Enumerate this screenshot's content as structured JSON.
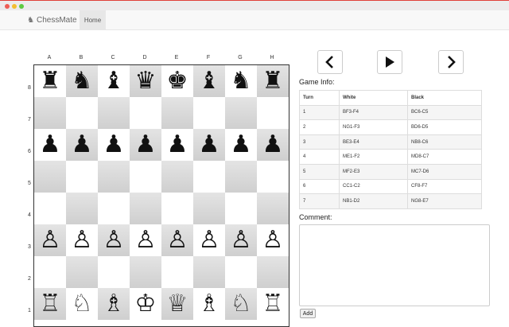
{
  "app": {
    "brand_name": "ChessMate",
    "brand_icon": "knight-icon",
    "nav": {
      "home_label": "Home"
    }
  },
  "board": {
    "files": [
      "A",
      "B",
      "C",
      "D",
      "E",
      "F",
      "G",
      "H"
    ],
    "ranks": [
      "8",
      "7",
      "6",
      "5",
      "4",
      "3",
      "2",
      "1"
    ],
    "rows": [
      [
        "♜",
        "♞",
        "♝",
        "♛",
        "♚",
        "♝",
        "♞",
        "♜"
      ],
      [
        "",
        "",
        "",
        "",
        "",
        "",
        "",
        ""
      ],
      [
        "♟",
        "♟",
        "♟",
        "♟",
        "♟",
        "♟",
        "♟",
        "♟"
      ],
      [
        "",
        "",
        "",
        "",
        "",
        "",
        "",
        ""
      ],
      [
        "",
        "",
        "",
        "",
        "",
        "",
        "",
        ""
      ],
      [
        "♙",
        "♙",
        "♙",
        "♙",
        "♙",
        "♙",
        "♙",
        "♙"
      ],
      [
        "",
        "",
        "",
        "",
        "",
        "",
        "",
        ""
      ],
      [
        "♖",
        "♘",
        "♗",
        "♔",
        "♕",
        "♗",
        "♘",
        "♖"
      ]
    ]
  },
  "controls": {
    "prev_icon": "chevron-left-icon",
    "play_icon": "play-icon",
    "next_icon": "chevron-right-icon"
  },
  "game_info": {
    "title": "Game Info:",
    "headers": [
      "Turn",
      "White",
      "Black"
    ],
    "rows": [
      [
        "1",
        "BF3-F4",
        "BC6-C5"
      ],
      [
        "2",
        "NG1-F3",
        "BD6-D5"
      ],
      [
        "3",
        "BE3-E4",
        "NB8-C6"
      ],
      [
        "4",
        "ME1-F2",
        "MD8-C7"
      ],
      [
        "5",
        "MF2-E3",
        "MC7-D6"
      ],
      [
        "6",
        "CC1-C2",
        "CF8-F7"
      ],
      [
        "7",
        "NB1-D2",
        "NG8-E7"
      ]
    ]
  },
  "comment": {
    "title": "Comment:",
    "value": "",
    "add_label": "Add"
  }
}
